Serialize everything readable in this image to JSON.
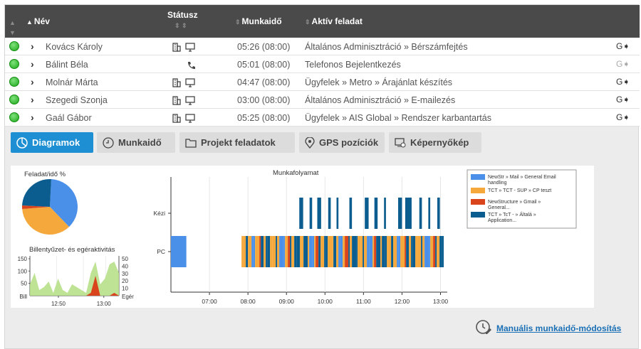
{
  "table": {
    "headers": {
      "name": "Név",
      "status": "Státusz",
      "worktime": "Munkaidő",
      "active_task": "Aktív feladat"
    },
    "rows": [
      {
        "name": "Kovács Károly",
        "devices": [
          "building-icon",
          "monitor-icon"
        ],
        "worktime": "05:26 (08:00)",
        "task": "Általános Adminisztráció » Bérszámfejtés",
        "action_enabled": true
      },
      {
        "name": "Bálint Béla",
        "devices": [
          "phone-icon"
        ],
        "worktime": "05:01 (08:00)",
        "task": "Telefonos Bejelentkezés",
        "action_enabled": false
      },
      {
        "name": "Molnár Márta",
        "devices": [
          "building-icon",
          "monitor-icon"
        ],
        "worktime": "04:47 (08:00)",
        "task": "Ügyfelek » Metro » Árajánlat készítés",
        "action_enabled": true
      },
      {
        "name": "Szegedi Szonja",
        "devices": [
          "building-icon",
          "monitor-icon"
        ],
        "worktime": "03:00 (08:00)",
        "task": "Általános Adminisztráció » E-mailezés",
        "action_enabled": true
      },
      {
        "name": "Gaál Gábor",
        "devices": [
          "building-icon",
          "monitor-icon"
        ],
        "worktime": "05:25 (08:00)",
        "task": "Ügyfelek » AIS Global » Rendszer karbantartás",
        "action_enabled": true
      }
    ]
  },
  "tabs": [
    {
      "label": "Diagramok",
      "icon": "chart-icon",
      "active": true
    },
    {
      "label": "Munkaidő",
      "icon": "clock-icon",
      "active": false
    },
    {
      "label": "Projekt feladatok",
      "icon": "folder-icon",
      "active": false
    },
    {
      "label": "GPS pozíciók",
      "icon": "location-pin-icon",
      "active": false
    },
    {
      "label": "Képernyőkép",
      "icon": "screenshot-icon",
      "active": false
    }
  ],
  "colors": {
    "accent": "#1e8fd2",
    "blue": "#4a8fe8",
    "orange": "#f5a83b",
    "red": "#d9441c",
    "navy": "#0c5d8f",
    "green": "#1da81a"
  },
  "chart_data": [
    {
      "type": "pie",
      "title": "Feladat/idő %",
      "slices": [
        {
          "label": "NewStr » Mail » General Email handling",
          "value": 37,
          "color": "#4a8fe8"
        },
        {
          "label": "TCT » TCT - SUP » CP teszt",
          "value": 36,
          "color": "#f5a83b"
        },
        {
          "label": "NewStructure » Gmail » General...",
          "value": 2,
          "color": "#d9441c"
        },
        {
          "label": "TCT » TcT - » Általá » Application...",
          "value": 25,
          "color": "#0c5d8f"
        }
      ]
    },
    {
      "type": "area",
      "title": "Billentyűzet- és egéraktivitás",
      "y_left": {
        "label": "Bill",
        "ticks": [
          50,
          100,
          150
        ]
      },
      "y_right": {
        "label": "Egér",
        "ticks": [
          10,
          20,
          30,
          40,
          50
        ]
      },
      "x_ticks": [
        "12:50",
        "13:00"
      ],
      "x": [
        0,
        1,
        2,
        3,
        4,
        5,
        6,
        7,
        8,
        9,
        10,
        11,
        12,
        13,
        14,
        15,
        16,
        17,
        18,
        19
      ],
      "series": [
        {
          "color": "#d9441c",
          "values": [
            0,
            0,
            0,
            0,
            0,
            0,
            0,
            0,
            0,
            0,
            0,
            0,
            0,
            5,
            35,
            0,
            0,
            0,
            5,
            0
          ]
        },
        {
          "color": "#b7e08a",
          "values": [
            20,
            40,
            10,
            15,
            25,
            5,
            30,
            10,
            5,
            20,
            15,
            10,
            5,
            40,
            60,
            20,
            30,
            55,
            60,
            40
          ]
        }
      ]
    },
    {
      "type": "timeline",
      "title": "Munkafolyamat",
      "categories": [
        "Kézi",
        "PC"
      ],
      "x_ticks": [
        "07:00",
        "08:00",
        "09:00",
        "10:00",
        "11:00",
        "12:00",
        "13:00"
      ],
      "legend": [
        {
          "label": "NewStr » Mail » General Email handling",
          "color": "#4a8fe8"
        },
        {
          "label": "TCT » TCT - SUP » CP teszt",
          "color": "#f5a83b"
        },
        {
          "label": "NewStructure » Gmail » General...",
          "color": "#d9441c"
        },
        {
          "label": "TCT » TcT - » Általá » Application...",
          "color": "#0c5d8f"
        }
      ],
      "x_range": [
        "06:00",
        "13:05"
      ],
      "pc_segments": [
        {
          "start": "06:00",
          "end": "06:24",
          "color": "#4a8fe8"
        },
        {
          "start": "07:50",
          "end": "13:05",
          "color": "mixed"
        }
      ],
      "manual_segments": [
        {
          "start": "09:20",
          "end": "09:26"
        },
        {
          "start": "09:36",
          "end": "09:40"
        },
        {
          "start": "09:48",
          "end": "09:54"
        },
        {
          "start": "10:05",
          "end": "10:09"
        },
        {
          "start": "10:18",
          "end": "10:21"
        },
        {
          "start": "10:38",
          "end": "10:42"
        },
        {
          "start": "11:02",
          "end": "11:08"
        },
        {
          "start": "11:17",
          "end": "11:22"
        },
        {
          "start": "11:32",
          "end": "11:35"
        },
        {
          "start": "11:54",
          "end": "12:00"
        },
        {
          "start": "12:05",
          "end": "12:15"
        },
        {
          "start": "12:27",
          "end": "12:31"
        },
        {
          "start": "12:41",
          "end": "12:44"
        },
        {
          "start": "12:55",
          "end": "12:59"
        }
      ]
    }
  ],
  "footer": {
    "link": "Manuális munkaidő-módosítás"
  }
}
